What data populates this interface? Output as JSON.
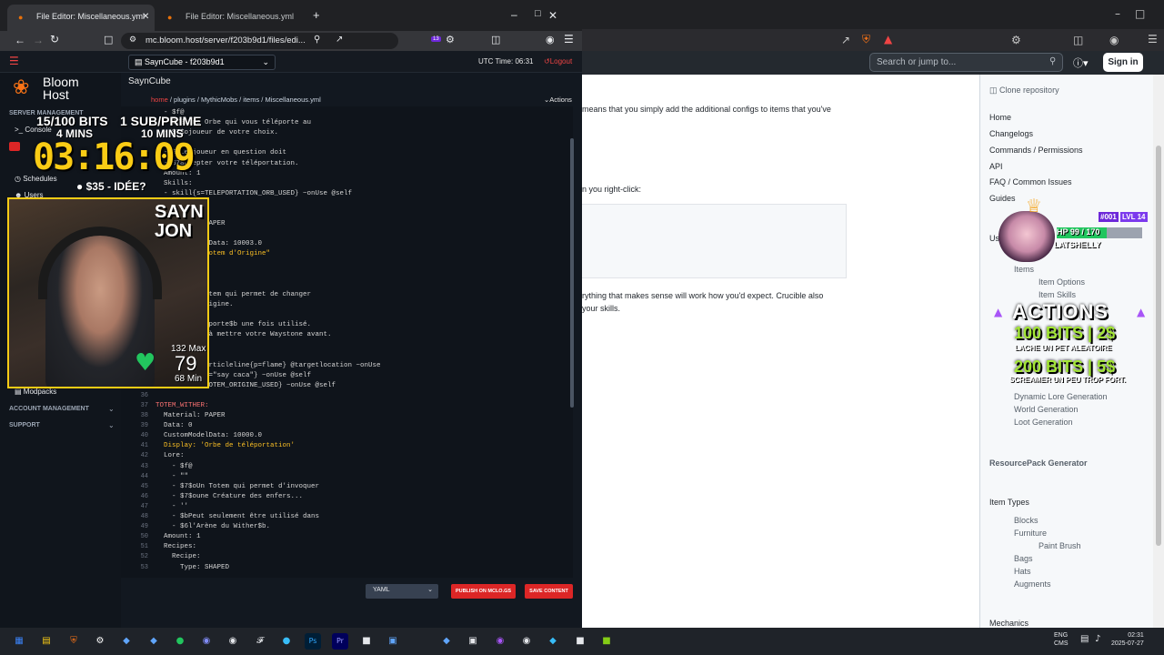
{
  "fg_browser": {
    "tabs": [
      {
        "label": "File Editor: Miscellaneous.yml"
      },
      {
        "label": "File Editor: Miscellaneous.yml"
      }
    ],
    "url": "mc.bloom.host/server/f203b9d1/files/edi...",
    "badge_count": "13"
  },
  "app": {
    "logo": "Bloom Host",
    "server_select": "SaynCube - f203b9d1",
    "utc_time": "UTC Time: 06:31",
    "logout": "Logout",
    "page_title": "SaynCube",
    "breadcrumb": {
      "home": "home",
      "rest": " / plugins / MythicMobs / items / Miscellaneous.yml"
    },
    "actions": "Actions",
    "sidebar": {
      "section_server": "SERVER MANAGEMENT",
      "items": [
        "Console",
        "Schedules",
        "Users",
        "Modpacks"
      ],
      "section_account": "ACCOUNT MANAGEMENT",
      "section_support": "SUPPORT"
    },
    "language": "YAML",
    "publish": "PUBLISH ON MCLO.GS",
    "save": "SAVE CONTENT"
  },
  "code_lines": [
    {
      "n": "",
      "text": "  - $f@",
      "cls": "c"
    },
    {
      "n": "",
      "text": "  - $7$oUne Orbe qui vous téléporte au",
      "cls": "c"
    },
    {
      "n": "",
      "text": "  - $7$ojoueur de votre choix.",
      "cls": "c"
    },
    {
      "n": "",
      "text": "",
      "cls": "c"
    },
    {
      "n": "",
      "text": "  - $7Le joueur en question doit",
      "cls": "c"
    },
    {
      "n": "",
      "text": "  - $7accepter votre téléportation.",
      "cls": "c"
    },
    {
      "n": "",
      "text": "  Amount: 1",
      "cls": "c"
    },
    {
      "n": "",
      "text": "  Skills:",
      "cls": "c"
    },
    {
      "n": "",
      "text": "  - skill{s=TELEPORTATION_ORB_USED} ~onUse @self",
      "cls": "c"
    },
    {
      "n": "",
      "text": "",
      "cls": "c"
    },
    {
      "n": "",
      "text": "",
      "cls": "c"
    },
    {
      "n": "",
      "text": "  Material: PAPER",
      "cls": "c"
    },
    {
      "n": "",
      "text": "",
      "cls": "c"
    },
    {
      "n": "",
      "text": "  CustomModelData: 10003.0",
      "cls": "c"
    },
    {
      "n": "",
      "text": "  Display: 'Totem d'Origine\"",
      "cls": "s"
    },
    {
      "n": "",
      "text": "",
      "cls": "c"
    },
    {
      "n": "",
      "text": "",
      "cls": "c"
    },
    {
      "n": "",
      "text": "",
      "cls": "c"
    },
    {
      "n": "",
      "text": "  - $7$oUn Totem qui permet de changer",
      "cls": "c"
    },
    {
      "n": "",
      "text": "  - $7$ode Origine.",
      "cls": "c"
    },
    {
      "n": "",
      "text": "",
      "cls": "c"
    },
    {
      "n": "",
      "text": "  - $7Se téléporte$b une fois utilisé.",
      "cls": "c"
    },
    {
      "n": "",
      "text": "  - $7Pensez à mettre votre Waystone avant.",
      "cls": "c"
    },
    {
      "n": "",
      "text": "",
      "cls": "c"
    },
    {
      "n": "",
      "text": "",
      "cls": "c"
    },
    {
      "n": "",
      "text": "  - effect:particleline{p=flame} @targetlocation ~onUse",
      "cls": "c"
    },
    {
      "n": "",
      "text": "  - message{c=\"say caca\"} ~onUse @self",
      "cls": "c"
    },
    {
      "n": "35",
      "text": "  - skill{s=TOTEM_ORIGINE_USED} ~onUse @self",
      "cls": "c"
    },
    {
      "n": "36",
      "text": "",
      "cls": "c"
    },
    {
      "n": "37",
      "text": "TOTEM_WITHER:",
      "cls": "k"
    },
    {
      "n": "38",
      "text": "  Material: PAPER",
      "cls": "c"
    },
    {
      "n": "39",
      "text": "  Data: 0",
      "cls": "c"
    },
    {
      "n": "40",
      "text": "  CustomModelData: 10000.0",
      "cls": "c"
    },
    {
      "n": "41",
      "text": "  Display: 'Orbe de téléportation'",
      "cls": "s"
    },
    {
      "n": "42",
      "text": "  Lore:",
      "cls": "c"
    },
    {
      "n": "43",
      "text": "    - $f@",
      "cls": "c"
    },
    {
      "n": "44",
      "text": "    - \"\"",
      "cls": "c"
    },
    {
      "n": "45",
      "text": "    - $7$oUn Totem qui permet d'invoquer",
      "cls": "c"
    },
    {
      "n": "46",
      "text": "    - $7$oune Créature des enfers...",
      "cls": "c"
    },
    {
      "n": "47",
      "text": "    - ''",
      "cls": "c"
    },
    {
      "n": "48",
      "text": "    - $bPeut seulement être utilisé dans",
      "cls": "c"
    },
    {
      "n": "49",
      "text": "    - $6l'Arène du Wither$b.",
      "cls": "c"
    },
    {
      "n": "50",
      "text": "  Amount: 1",
      "cls": "c"
    },
    {
      "n": "51",
      "text": "  Recipes:",
      "cls": "c"
    },
    {
      "n": "52",
      "text": "    Recipe:",
      "cls": "c"
    },
    {
      "n": "53",
      "text": "      Type: SHAPED",
      "cls": "c"
    }
  ],
  "bg_browser": {
    "search": "Search or jump to...",
    "sign_in": "Sign in",
    "clone": "Clone repository",
    "doc_lines": [
      "means that you simply add the additional configs to items that you've",
      "n you right-click:",
      "rything that makes sense will work how you'd expect. Crucible also",
      "your skills."
    ],
    "nav": {
      "top": [
        "Home",
        "Changelogs",
        "Commands / Permissions",
        "API",
        "FAQ / Common Issues",
        "Guides"
      ],
      "usage": "Us",
      "items_link": "Items",
      "sub1": [
        "Item Options",
        "Item Skills"
      ],
      "gen": [
        "Dynamic Lore Generation",
        "World Generation",
        "Loot Generation"
      ],
      "resourcepack": "ResourcePack Generator",
      "item_types": "Item Types",
      "types": [
        "Blocks",
        "Furniture"
      ],
      "paint": "Paint Brush",
      "types2": [
        "Bags",
        "Hats",
        "Augments"
      ],
      "mechanics": "Mechanics"
    }
  },
  "overlay": {
    "bits": "15/100 BITS",
    "bits_mins": "4 MINS",
    "sub": "1 SUB/PRIME",
    "sub_mins": "10 MINS",
    "timer": "03:16:09",
    "idea": "$35 - IDÉE?",
    "cam_name": "SAYN\nJON",
    "hr_max": "132 Max",
    "hr_value": "79",
    "hr_min": "68 Min",
    "vt_id": "#001",
    "vt_lvl": "LVL 14",
    "vt_hp": "HP 99 / 170",
    "vt_hp_fraction": 0.58,
    "vt_name": "LATSHELLY",
    "actions_title": "ACTIONS",
    "act1_big": "100 BITS | 2$",
    "act1_small": "LACHE UN PET ALEATOIRE",
    "act2_big": "200 BITS | 5$",
    "act2_small": "SCREAMER UN PEU TROP FORT."
  },
  "taskbar": {
    "lang1": "ENG",
    "lang2": "CMS",
    "time": "02:31",
    "date": "2025-07-27"
  },
  "colors": {
    "accent": "#dc2626",
    "timer": "#facc15",
    "brand": "#f97316"
  }
}
